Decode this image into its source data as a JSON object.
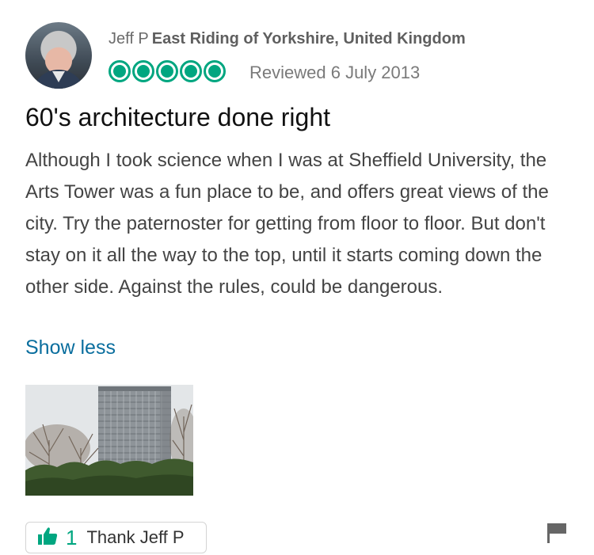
{
  "review": {
    "reviewer_name": "Jeff P",
    "reviewer_location": "East Riding of Yorkshire, United Kingdom",
    "rating": 5,
    "rating_max": 5,
    "reviewed_date": "Reviewed 6 July 2013",
    "title": "60's architecture done right",
    "body": "Although I took science when I was at Sheffield University, the Arts Tower was a fun place to be, and offers great views of the city. Try the paternoster for getting from floor to floor. But don't stay on it all the way to the top, until it starts coming down the other side. Against the rules, could be dangerous.",
    "show_less_label": "Show less"
  },
  "actions": {
    "thank_count": "1",
    "thank_label": "Thank Jeff P",
    "thumbs_up_icon": "thumbs-up-icon",
    "flag_icon": "flag-icon"
  },
  "colors": {
    "accent_green": "#00a680",
    "link_blue": "#0a6e9e"
  }
}
